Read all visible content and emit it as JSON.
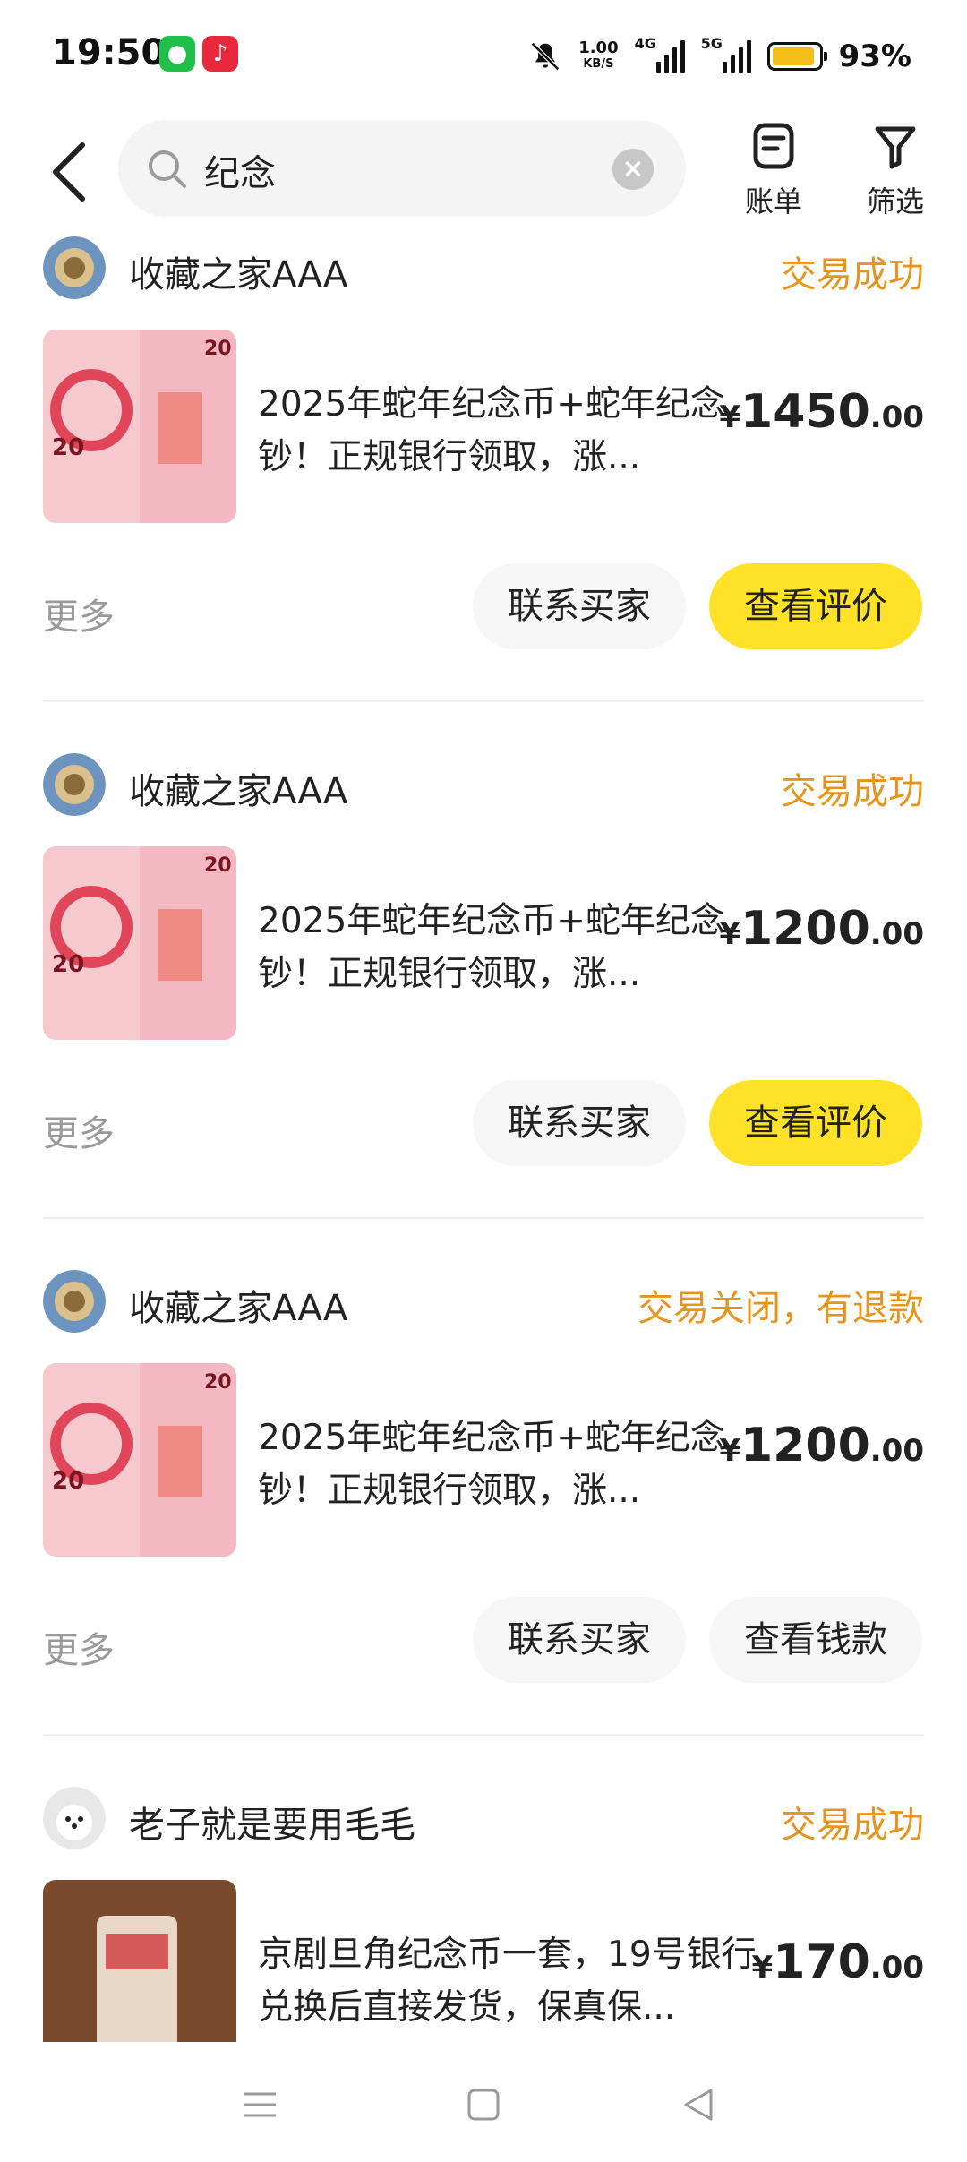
{
  "status_bar": {
    "time": "19:50",
    "app_icons": [
      "wechat-icon",
      "music-icon"
    ],
    "mute_icon": "bell-off-icon",
    "net_speed_value": "1.00",
    "net_speed_unit": "KB/S",
    "net_type_1": "4G",
    "net_type_2": "5G",
    "battery_level": 0.93,
    "battery_percent": "93%",
    "battery_color": "#f5bd17"
  },
  "header": {
    "search_value": "纪念",
    "search_icon": "search-icon",
    "clear_icon": "clear-icon",
    "bill_label": "账单",
    "filter_label": "筛选"
  },
  "colors": {
    "status_text": "#e8941a",
    "primary_button": "#ffe228",
    "secondary_button": "#f6f6f6",
    "muted_text": "#9a9a9a"
  },
  "orders": [
    {
      "shop_name": "收藏之家AAA",
      "status": "交易成功",
      "title": "2025年蛇年纪念币+蛇年纪念钞！正规银行领取，涨...",
      "price_symbol": "¥",
      "price_int": "1450",
      "price_dec": ".00",
      "more_label": "更多",
      "contact_label": "联系买家",
      "action_label": "查看评价"
    },
    {
      "shop_name": "收藏之家AAA",
      "status": "交易成功",
      "title": "2025年蛇年纪念币+蛇年纪念钞！正规银行领取，涨...",
      "price_symbol": "¥",
      "price_int": "1200",
      "price_dec": ".00",
      "more_label": "更多",
      "contact_label": "联系买家",
      "action_label": "查看评价"
    },
    {
      "shop_name": "收藏之家AAA",
      "status": "交易关闭，有退款",
      "title": "2025年蛇年纪念币+蛇年纪念钞！正规银行领取，涨...",
      "price_symbol": "¥",
      "price_int": "1200",
      "price_dec": ".00",
      "more_label": "更多",
      "contact_label": "联系买家",
      "action_label": "查看钱款"
    },
    {
      "shop_name": "老子就是要用毛毛",
      "status": "交易成功",
      "title": "京剧旦角纪念币一套，19号银行兑换后直接发货，保真保...",
      "price_symbol": "¥",
      "price_int": "170",
      "price_dec": ".00"
    }
  ],
  "nav_bar": {
    "items": [
      "menu-icon",
      "home-square-icon",
      "back-triangle-icon"
    ]
  }
}
